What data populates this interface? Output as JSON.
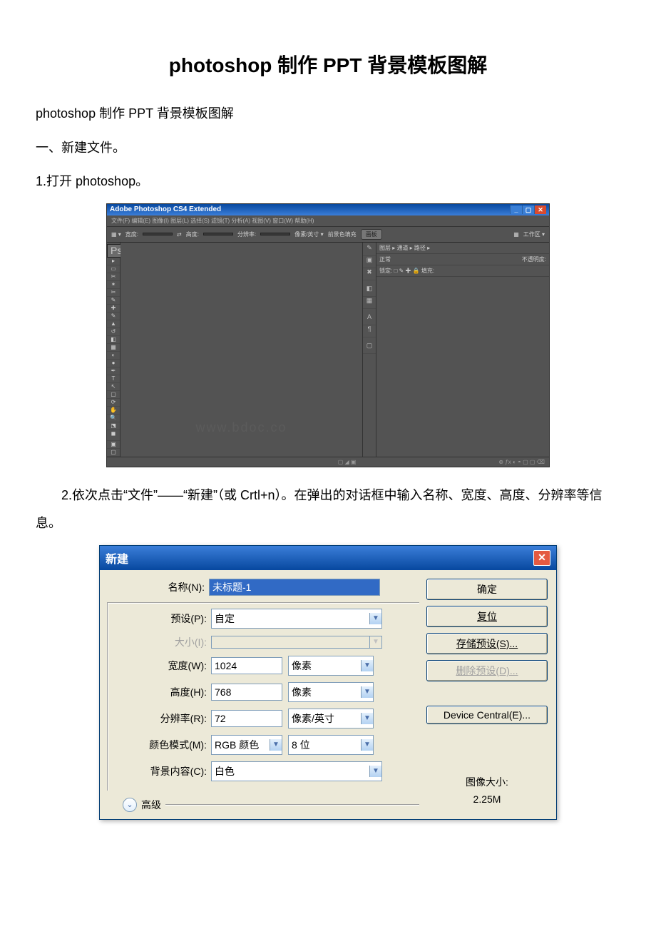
{
  "doc": {
    "title": "photoshop 制作 PPT 背景模板图解",
    "p1": "photoshop 制作 PPT 背景模板图解",
    "p2": "一、新建文件。",
    "p3": "1.打开 photoshop。",
    "p4": "2.依次点击“文件”——“新建”（或 Crtl+n）。在弹出的对话框中输入名称、宽度、高度、分辨率等信息。"
  },
  "ps": {
    "title": "Adobe Photoshop CS4 Extended",
    "menu": "文件(F)  编辑(E)  图像(I)  图层(L)  选择(S)  滤镜(T)  分析(A)  视图(V)  窗口(W)  帮助(H)",
    "opt_label1": "宽度:",
    "opt_label2": "高度:",
    "opt_label3": "分辨率:",
    "opt_label4": "像素/英寸",
    "opt_label5": "前景色填充",
    "opt_btn": "画板",
    "opt_work": "工作区 ▾",
    "panel1": "图层 ▸ 通道 ▸ 路径 ▸",
    "panel2": "正常",
    "panel2b": "不透明度:",
    "panel3": "锁定: □ ✎ ✚ 🔒   填充:",
    "watermark": "www.bdoc.co"
  },
  "dlg": {
    "title": "新建",
    "name_label": "名称(N):",
    "name_value": "未标题-1",
    "preset_label": "预设(P):",
    "preset_value": "自定",
    "size_label": "大小(I):",
    "width_label": "宽度(W):",
    "width_value": "1024",
    "width_unit": "像素",
    "height_label": "高度(H):",
    "height_value": "768",
    "height_unit": "像素",
    "res_label": "分辨率(R):",
    "res_value": "72",
    "res_unit": "像素/英寸",
    "mode_label": "颜色模式(M):",
    "mode_value": "RGB 颜色",
    "depth_value": "8 位",
    "bg_label": "背景内容(C):",
    "bg_value": "白色",
    "advanced": "高级",
    "ok": "确定",
    "reset": "复位",
    "save_preset": "存储预设(S)...",
    "del_preset": "删除预设(D)...",
    "device_central": "Device Central(E)...",
    "image_size_label": "图像大小:",
    "image_size_value": "2.25M"
  }
}
